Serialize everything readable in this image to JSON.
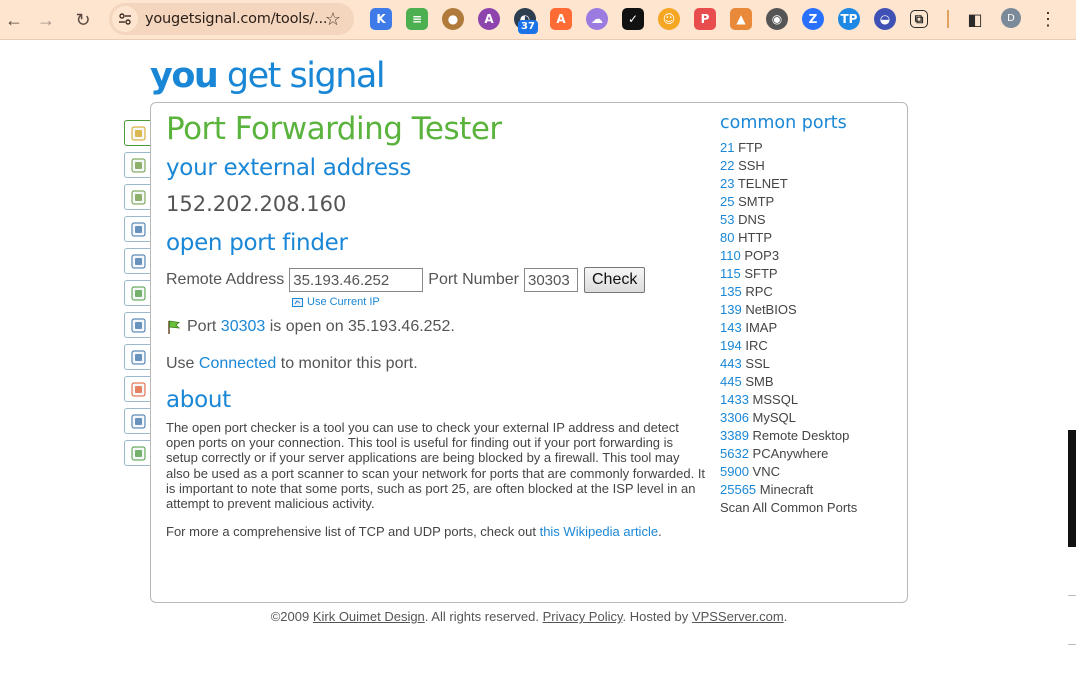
{
  "browser": {
    "url": "yougetsignal.com/tools/...",
    "profile_initial": "D",
    "notification_badge": "37",
    "extensions": [
      {
        "name": "k-extension-icon",
        "glyph": "K",
        "bg": "#3f7be8"
      },
      {
        "name": "stack-extension-icon",
        "glyph": "≡",
        "bg": "#4caf50"
      },
      {
        "name": "cookie-extension-icon",
        "glyph": "●",
        "bg": "#b07a3a"
      },
      {
        "name": "anchor-extension-icon",
        "glyph": "A",
        "bg": "#8e44ad"
      },
      {
        "name": "gauge-extension-icon",
        "glyph": "◐",
        "bg": "#2c3e50"
      },
      {
        "name": "a-extension-icon",
        "glyph": "A",
        "bg": "#ff6b35"
      },
      {
        "name": "ghost-extension-icon",
        "glyph": "☁",
        "bg": "#9b7be0"
      },
      {
        "name": "shield-extension-icon",
        "glyph": "✓",
        "bg": "#111111"
      },
      {
        "name": "avatar-extension-icon",
        "glyph": "☺",
        "bg": "#f5a623"
      },
      {
        "name": "p-extension-icon",
        "glyph": "P",
        "bg": "#e84c4c"
      },
      {
        "name": "fox-extension-icon",
        "glyph": "▲",
        "bg": "#e88a3a"
      },
      {
        "name": "owl-extension-icon",
        "glyph": "◉",
        "bg": "#555555"
      },
      {
        "name": "z-extension-icon",
        "glyph": "Z",
        "bg": "#2970ff"
      },
      {
        "name": "tp-extension-icon",
        "glyph": "TP",
        "bg": "#1e88e5"
      },
      {
        "name": "chat-extension-icon",
        "glyph": "◒",
        "bg": "#3f51b5"
      },
      {
        "name": "puzzle-extension-icon",
        "glyph": "⧉",
        "bg": "#fde5cf"
      }
    ]
  },
  "logo": {
    "part1": "you",
    "part2": "get",
    "part3": "signal"
  },
  "title": "Port Forwarding Tester",
  "external": {
    "heading": "your external address",
    "ip": "152.202.208.160"
  },
  "finder": {
    "heading": "open port finder",
    "remote_label": "Remote Address",
    "remote_value": "35.193.46.252",
    "port_label": "Port Number",
    "port_value": "30303",
    "check_label": "Check",
    "use_current_ip": "Use Current IP"
  },
  "result": {
    "prefix": "Port",
    "port": "30303",
    "suffix": "is open on 35.193.46.252."
  },
  "monitor": {
    "prefix": "Use",
    "link": "Connected",
    "suffix": "to monitor this port."
  },
  "about": {
    "heading": "about",
    "text": "The open port checker is a tool you can use to check your external IP address and detect open ports on your connection. This tool is useful for finding out if your port forwarding is setup correctly or if your server applications are being blocked by a firewall. This tool may also be used as a port scanner to scan your network for ports that are commonly forwarded. It is important to note that some ports, such as port 25, are often blocked at the ISP level in an attempt to prevent malicious activity.",
    "more_prefix": "For more a comprehensive list of TCP and UDP ports, check out",
    "more_link": "this Wikipedia article",
    "more_suffix": "."
  },
  "common_ports": {
    "heading": "common ports",
    "items": [
      {
        "port": "21",
        "name": "FTP"
      },
      {
        "port": "22",
        "name": "SSH"
      },
      {
        "port": "23",
        "name": "TELNET"
      },
      {
        "port": "25",
        "name": "SMTP"
      },
      {
        "port": "53",
        "name": "DNS"
      },
      {
        "port": "80",
        "name": "HTTP"
      },
      {
        "port": "110",
        "name": "POP3"
      },
      {
        "port": "115",
        "name": "SFTP"
      },
      {
        "port": "135",
        "name": "RPC"
      },
      {
        "port": "139",
        "name": "NetBIOS"
      },
      {
        "port": "143",
        "name": "IMAP"
      },
      {
        "port": "194",
        "name": "IRC"
      },
      {
        "port": "443",
        "name": "SSL"
      },
      {
        "port": "445",
        "name": "SMB"
      },
      {
        "port": "1433",
        "name": "MSSQL"
      },
      {
        "port": "3306",
        "name": "MySQL"
      },
      {
        "port": "3389",
        "name": "Remote Desktop"
      },
      {
        "port": "5632",
        "name": "PCAnywhere"
      },
      {
        "port": "5900",
        "name": "VNC"
      },
      {
        "port": "25565",
        "name": "Minecraft"
      }
    ],
    "scan_all": "Scan All Common Ports"
  },
  "footer": {
    "copyright": "©2009",
    "designer": "Kirk Ouimet Design",
    "rights": ". All rights reserved.",
    "privacy": "Privacy Policy",
    "hosted": ". Hosted by",
    "host": "VPSServer.com",
    "end": "."
  },
  "side_tabs": [
    {
      "name": "lock-tool-tab",
      "color": "#d4a017"
    },
    {
      "name": "map-tool-tab",
      "color": "#6a9a3a"
    },
    {
      "name": "map-pin-tool-tab",
      "color": "#6a9a3a"
    },
    {
      "name": "server-tool-tab",
      "color": "#3a6fa8"
    },
    {
      "name": "email-tool-tab",
      "color": "#3a6fa8"
    },
    {
      "name": "network-tool-tab",
      "color": "#4a9a3a"
    },
    {
      "name": "whois-tool-tab",
      "color": "#3a6fa8"
    },
    {
      "name": "google-tool-tab",
      "color": "#3a6fa8"
    },
    {
      "name": "windows-tool-tab",
      "color": "#e05a2a"
    },
    {
      "name": "drive-tool-tab",
      "color": "#3a6fa8"
    },
    {
      "name": "globe-tool-tab",
      "color": "#4a9a3a"
    }
  ]
}
